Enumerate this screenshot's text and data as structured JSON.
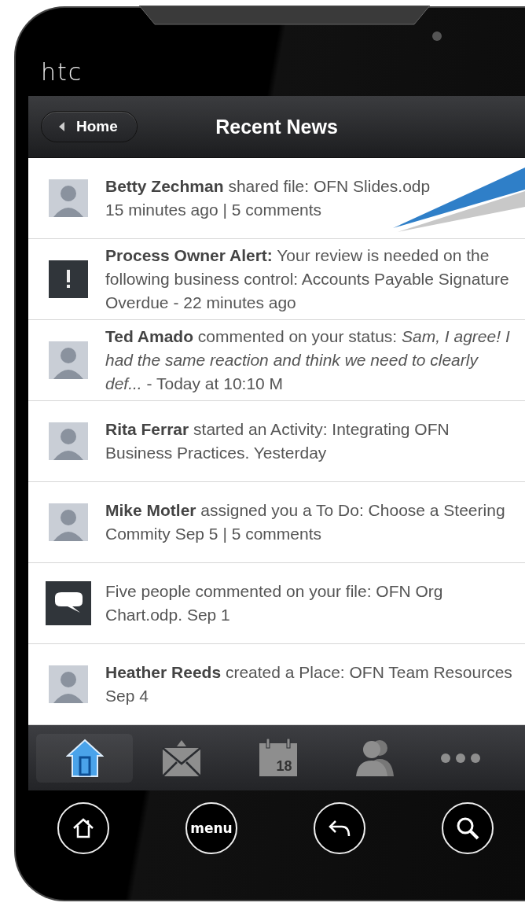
{
  "device": {
    "brand": "htc"
  },
  "header": {
    "back_button": "Home",
    "title": "Recent News"
  },
  "news": [
    {
      "kind": "avatar",
      "text": "**Betty Zechman** shared file: OFN Slides.odp",
      "meta": "15 minutes ago | 5 comments"
    },
    {
      "kind": "alert",
      "text": "**Process Owner Alert:** Your review is needed on the following business control: Accounts Payable Signature Overdue - 22 minutes ago"
    },
    {
      "kind": "avatar",
      "text": "**Ted Amado** commented on your status: *Sam, I agree! I had the same reaction and think we need to clearly def...* - Today at 10:10 M"
    },
    {
      "kind": "avatar",
      "text": "**Rita Ferrar** started an Activity: Integrating OFN Business Practices. Yesterday"
    },
    {
      "kind": "avatar",
      "text": "**Mike Motler** assigned you a To Do: Choose a Steering Commity Sep 5 | 5 comments"
    },
    {
      "kind": "comment",
      "text": "Five people commented on your file: OFN Org Chart.odp. Sep 1"
    },
    {
      "kind": "avatar",
      "text": "**Heather Reeds** created a Place: OFN Team Resources  Sep 4"
    }
  ],
  "tabs": [
    {
      "kind": "home",
      "selected": true
    },
    {
      "kind": "mail",
      "selected": false
    },
    {
      "kind": "calendar",
      "label": "18",
      "selected": false
    },
    {
      "kind": "people",
      "selected": false
    },
    {
      "kind": "more",
      "selected": false
    }
  ],
  "hardware_buttons": [
    {
      "kind": "home"
    },
    {
      "kind": "menu",
      "label": "menu"
    },
    {
      "kind": "back"
    },
    {
      "kind": "search"
    }
  ]
}
